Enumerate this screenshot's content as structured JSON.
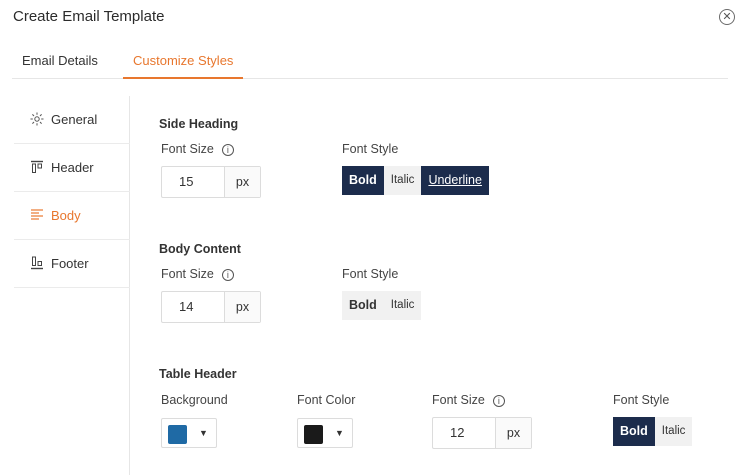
{
  "dialog": {
    "title": "Create Email Template",
    "close_glyph": "✕"
  },
  "tabs": {
    "email_details": "Email Details",
    "customize_styles": "Customize Styles",
    "active": "customize_styles"
  },
  "sidenav": {
    "items": [
      {
        "label": "General",
        "icon": "gear-icon"
      },
      {
        "label": "Header",
        "icon": "header-icon"
      },
      {
        "label": "Body",
        "icon": "body-icon",
        "active": true
      },
      {
        "label": "Footer",
        "icon": "footer-icon"
      }
    ]
  },
  "side_heading": {
    "title": "Side Heading",
    "font_size_label": "Font Size",
    "font_size_value": "15",
    "unit": "px",
    "font_style_label": "Font Style",
    "styles": {
      "bold": "Bold",
      "italic": "Italic",
      "underline": "Underline"
    },
    "active_styles": [
      "bold",
      "underline"
    ]
  },
  "body_content": {
    "title": "Body Content",
    "font_size_label": "Font Size",
    "font_size_value": "14",
    "unit": "px",
    "font_style_label": "Font Style",
    "styles": {
      "bold": "Bold",
      "italic": "Italic"
    },
    "active_styles": []
  },
  "table_header": {
    "title": "Table Header",
    "background_label": "Background",
    "background_color": "#1f6aa5",
    "font_color_label": "Font Color",
    "font_color": "#1a1a1a",
    "font_size_label": "Font Size",
    "font_size_value": "12",
    "unit": "px",
    "font_style_label": "Font Style",
    "styles": {
      "bold": "Bold",
      "italic": "Italic"
    },
    "active_styles": [
      "bold"
    ]
  },
  "colors": {
    "accent": "#e8772e",
    "active_button": "#1c2c4c"
  },
  "info_glyph": "i",
  "caret_glyph": "▼"
}
